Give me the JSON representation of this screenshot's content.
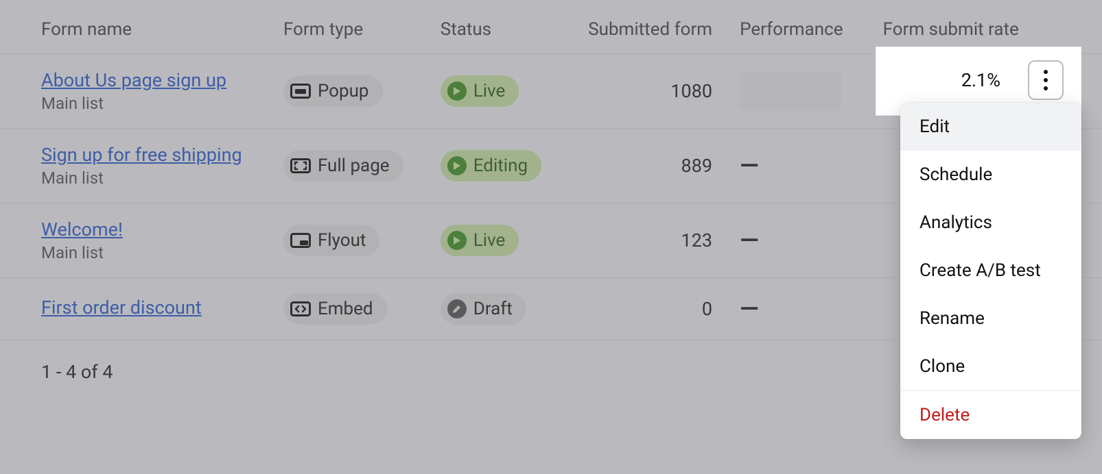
{
  "columns": {
    "name": "Form name",
    "type": "Form type",
    "status": "Status",
    "submitted": "Submitted form",
    "performance": "Performance",
    "rate": "Form submit rate"
  },
  "rows": [
    {
      "title": "About Us page sign up",
      "subtitle": "Main list",
      "type_label": "Popup",
      "type_icon": "popup",
      "status_label": "Live",
      "status_kind": "live",
      "submitted": "1080",
      "performance": "placeholder",
      "rate": "2.1%"
    },
    {
      "title": "Sign up for free shipping",
      "subtitle": "Main list",
      "type_label": "Full page",
      "type_icon": "fullpage",
      "status_label": "Editing",
      "status_kind": "editing",
      "submitted": "889",
      "performance": "dash",
      "rate": ""
    },
    {
      "title": "Welcome!",
      "subtitle": "Main list",
      "type_label": "Flyout",
      "type_icon": "flyout",
      "status_label": "Live",
      "status_kind": "live",
      "submitted": "123",
      "performance": "dash",
      "rate": ""
    },
    {
      "title": "First order discount",
      "subtitle": "",
      "type_label": "Embed",
      "type_icon": "embed",
      "status_label": "Draft",
      "status_kind": "draft",
      "submitted": "0",
      "performance": "dash",
      "rate": ""
    }
  ],
  "footer": "1 - 4 of 4",
  "menu": {
    "rate": "2.1%",
    "items": [
      {
        "label": "Edit",
        "hover": true
      },
      {
        "label": "Schedule"
      },
      {
        "label": "Analytics"
      },
      {
        "label": "Create A/B test"
      },
      {
        "label": "Rename"
      },
      {
        "label": "Clone"
      }
    ],
    "danger": {
      "label": "Delete"
    }
  }
}
